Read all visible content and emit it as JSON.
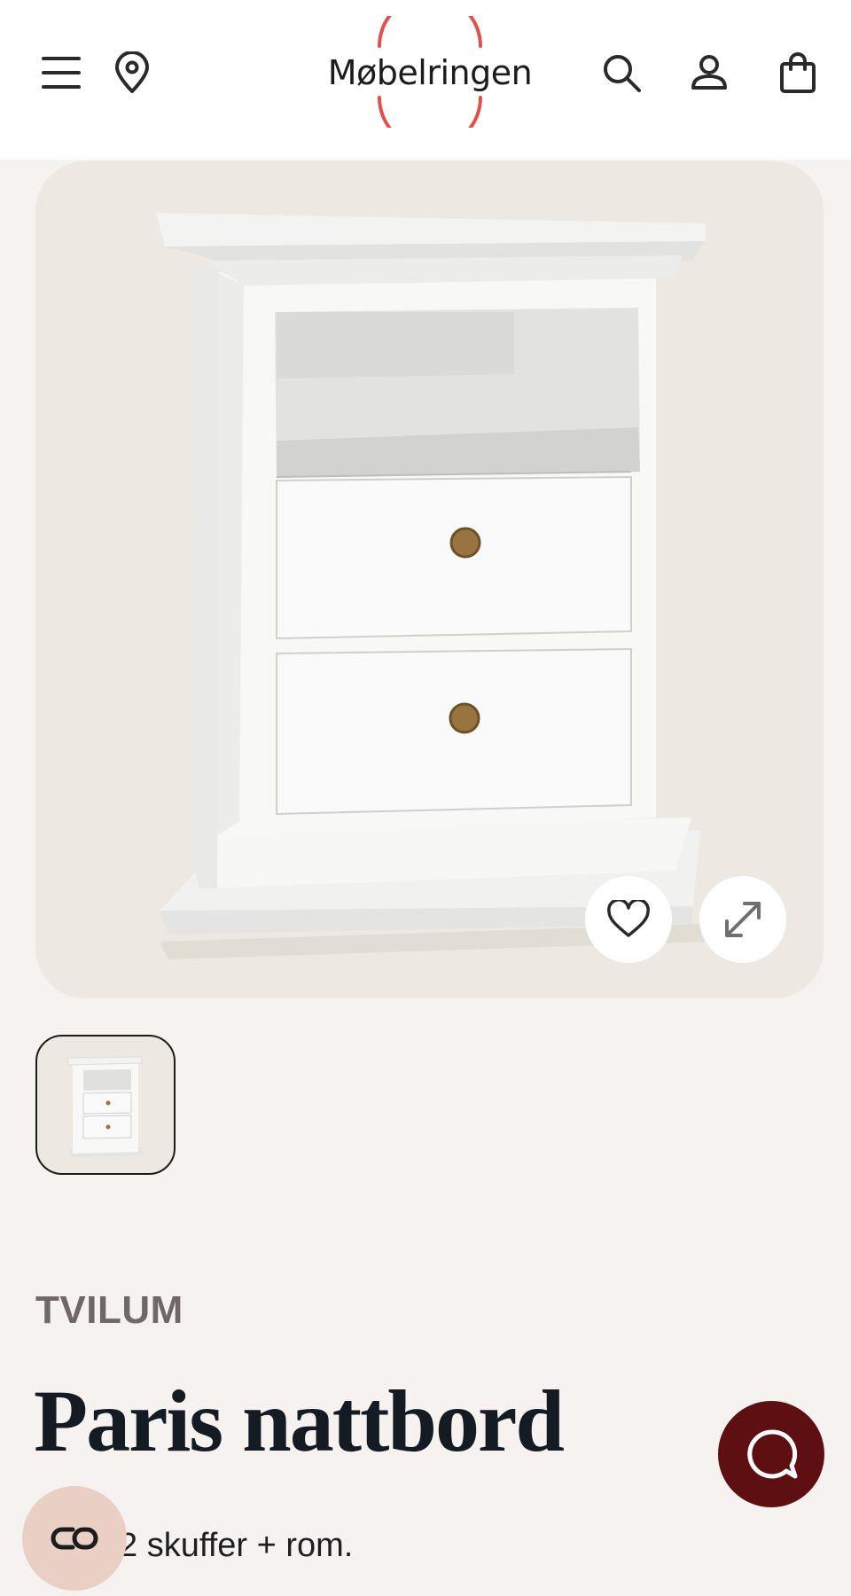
{
  "header": {
    "logo_text": "Møbelringen",
    "brand_color": "#e2504e",
    "icons": [
      "menu-icon",
      "location-pin-icon",
      "search-icon",
      "account-icon",
      "shopping-bag-icon"
    ]
  },
  "gallery": {
    "image_alt": "Paris nattbord",
    "actions": [
      "heart-icon",
      "expand-icon"
    ],
    "thumbnail_count": 1
  },
  "product": {
    "brand": "TVILUM",
    "title": "Paris nattbord",
    "description": "2 skuffer + rom."
  },
  "floating": {
    "chat_icon": "chat-icon",
    "chat_color": "#5e0f12",
    "accessibility_icon": "accessibility-icon",
    "accessibility_color": "#e9cfc4"
  }
}
